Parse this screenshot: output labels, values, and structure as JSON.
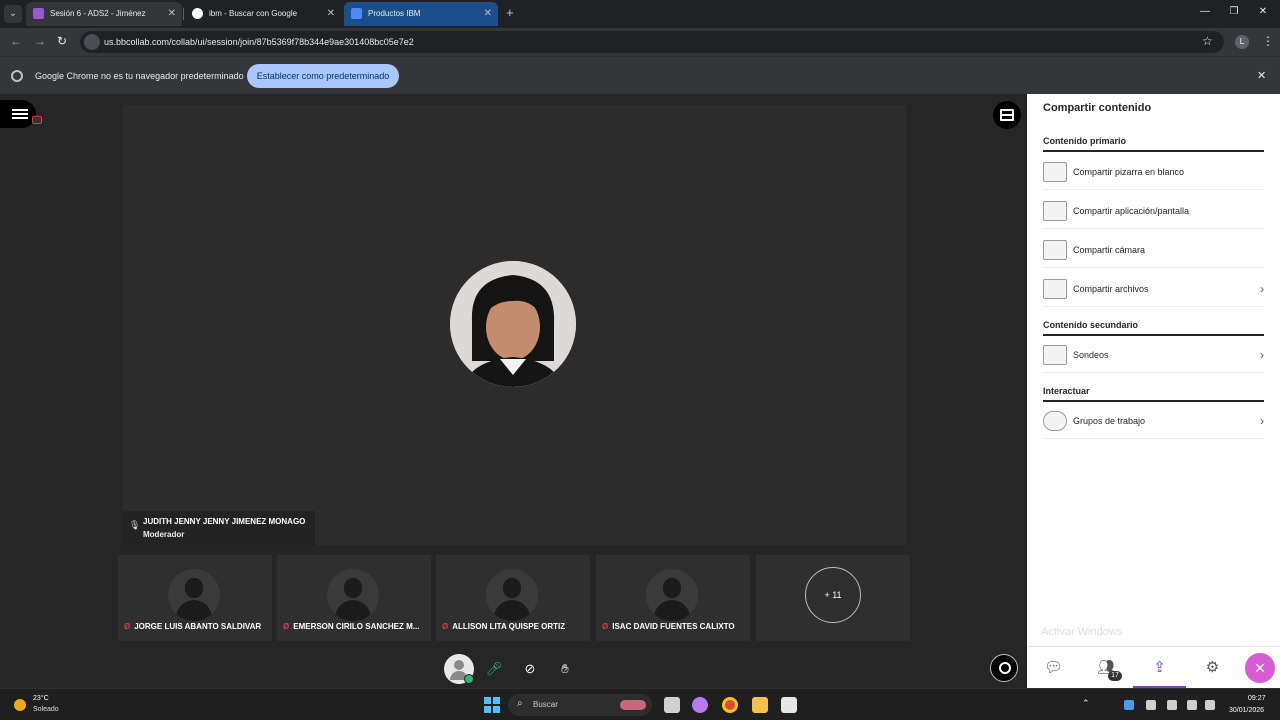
{
  "browser": {
    "tabs": [
      {
        "title": "Sesión 6 - ADS2 - Jiménez",
        "favicon_color": "#9b59d0"
      },
      {
        "title": "ibm - Buscar con Google",
        "favicon_color": "#ffffff"
      },
      {
        "title": "Productos IBM",
        "favicon_color": "#4c8bf5"
      }
    ],
    "url": "us.bbcollab.com/collab/ui/session/join/87b5369f78b344e9ae301408bc05e7e2",
    "infobar": {
      "message": "Google Chrome no es tu navegador predeterminado",
      "button": "Establecer como predeterminado"
    },
    "profile_initial": "L"
  },
  "session": {
    "presenter": {
      "name": "JUDITH JENNY JENNY JIMENEZ MONAGO",
      "role": "Moderador"
    },
    "participants": [
      {
        "name": "JORGE LUIS ABANTO SALDIVAR"
      },
      {
        "name": "EMERSON CIRILO SANCHEZ M..."
      },
      {
        "name": "ALLISON LITA QUISPE ORTIZ"
      },
      {
        "name": "ISAC DAVID FUENTES CALIXTO"
      }
    ],
    "more_count": "+ 11"
  },
  "panel": {
    "title": "Compartir contenido",
    "sections": [
      {
        "heading": "Contenido primario",
        "items": [
          {
            "label": "Compartir pizarra en blanco",
            "icon": "whiteboard-icon",
            "has_chevron": false
          },
          {
            "label": "Compartir aplicación/pantalla",
            "icon": "application-screen-icon",
            "has_chevron": false
          },
          {
            "label": "Compartir cámara",
            "icon": "camera-icon",
            "has_chevron": false
          },
          {
            "label": "Compartir archivos",
            "icon": "files-icon",
            "has_chevron": true
          }
        ]
      },
      {
        "heading": "Contenido secundario",
        "items": [
          {
            "label": "Sondeos",
            "icon": "polls-icon",
            "has_chevron": true
          }
        ]
      },
      {
        "heading": "Interactuar",
        "items": [
          {
            "label": "Grupos de trabajo",
            "icon": "breakout-groups-icon",
            "has_chevron": true
          }
        ]
      }
    ],
    "watermark": "Activar Windows",
    "attendee_badge": "17",
    "accent_color": "#7b3ec4"
  },
  "taskbar": {
    "weather": {
      "temp": "23°C",
      "condition": "Soleado"
    },
    "search_placeholder": "Buscar",
    "time": "09:27",
    "date": "30/01/2026"
  }
}
